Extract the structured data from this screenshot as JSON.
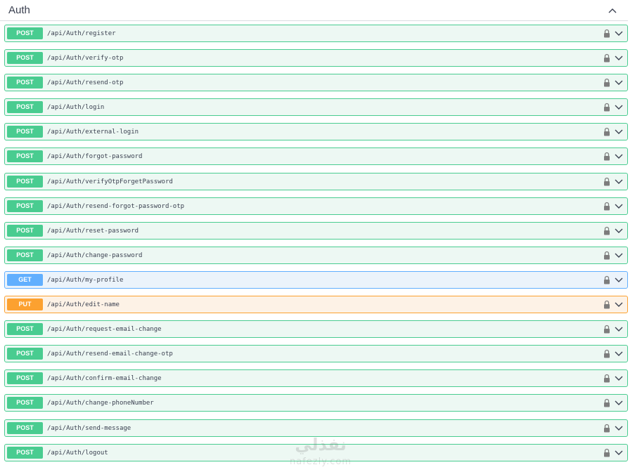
{
  "section": {
    "title": "Auth",
    "toggle_icon": "chevron-up-icon"
  },
  "operations": [
    {
      "method": "POST",
      "path": "/api/Auth/register"
    },
    {
      "method": "POST",
      "path": "/api/Auth/verify-otp"
    },
    {
      "method": "POST",
      "path": "/api/Auth/resend-otp"
    },
    {
      "method": "POST",
      "path": "/api/Auth/login"
    },
    {
      "method": "POST",
      "path": "/api/Auth/external-login"
    },
    {
      "method": "POST",
      "path": "/api/Auth/forgot-password"
    },
    {
      "method": "POST",
      "path": "/api/Auth/verifyOtpForgetPassword"
    },
    {
      "method": "POST",
      "path": "/api/Auth/resend-forgot-password-otp"
    },
    {
      "method": "POST",
      "path": "/api/Auth/reset-password"
    },
    {
      "method": "POST",
      "path": "/api/Auth/change-password"
    },
    {
      "method": "GET",
      "path": "/api/Auth/my-profile"
    },
    {
      "method": "PUT",
      "path": "/api/Auth/edit-name"
    },
    {
      "method": "POST",
      "path": "/api/Auth/request-email-change"
    },
    {
      "method": "POST",
      "path": "/api/Auth/resend-email-change-otp"
    },
    {
      "method": "POST",
      "path": "/api/Auth/confirm-email-change"
    },
    {
      "method": "POST",
      "path": "/api/Auth/change-phoneNumber"
    },
    {
      "method": "POST",
      "path": "/api/Auth/send-message"
    },
    {
      "method": "POST",
      "path": "/api/Auth/logout"
    }
  ],
  "colors": {
    "post": "#49cc90",
    "get": "#61affe",
    "put": "#fca130"
  },
  "watermark": {
    "arabic": "نفذلي",
    "latin": "nafezly.com"
  }
}
